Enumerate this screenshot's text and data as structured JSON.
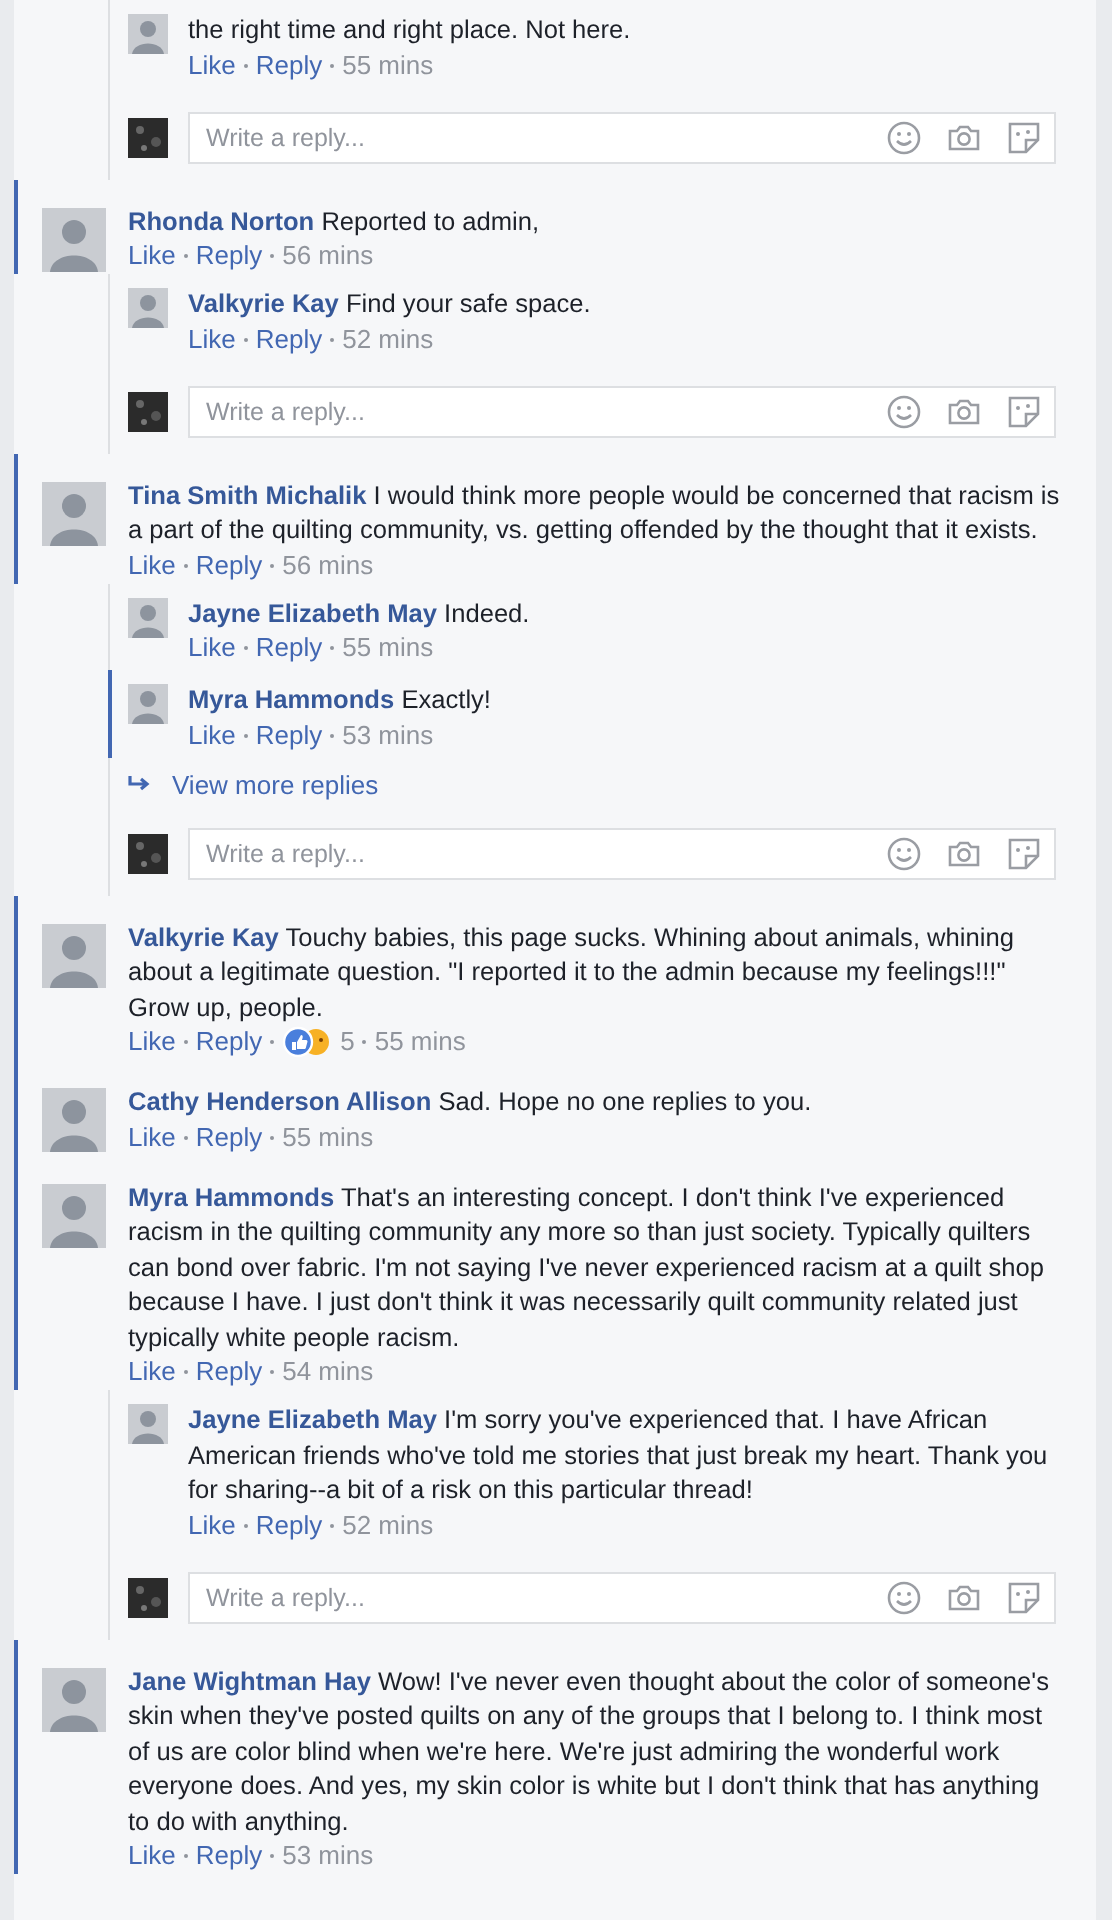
{
  "items": [
    {
      "kind": "reply",
      "unread": false,
      "text": "the right time and right place. Not here.",
      "like": "Like",
      "reply": "Reply",
      "time": "55 mins"
    },
    {
      "kind": "reply_box",
      "placeholder": "Write a reply..."
    },
    {
      "kind": "comment",
      "unread": true,
      "author": "Rhonda Norton",
      "text": "Reported to admin,",
      "like": "Like",
      "reply": "Reply",
      "time": "56 mins"
    },
    {
      "kind": "reply",
      "unread": false,
      "author": "Valkyrie Kay",
      "text": "Find your safe space.",
      "like": "Like",
      "reply": "Reply",
      "time": "52 mins"
    },
    {
      "kind": "reply_box",
      "placeholder": "Write a reply..."
    },
    {
      "kind": "comment",
      "unread": true,
      "author": "Tina Smith Michalik",
      "text": "I would think more people would be concerned that racism is a part of the quilting community, vs. getting offended by the thought that it exists.",
      "like": "Like",
      "reply": "Reply",
      "time": "56 mins"
    },
    {
      "kind": "reply",
      "unread": false,
      "author": "Jayne Elizabeth May",
      "text": "Indeed.",
      "like": "Like",
      "reply": "Reply",
      "time": "55 mins"
    },
    {
      "kind": "reply",
      "unread": true,
      "author": "Myra Hammonds",
      "text": "Exactly!",
      "like": "Like",
      "reply": "Reply",
      "time": "53 mins"
    },
    {
      "kind": "more_replies",
      "label": "View more replies"
    },
    {
      "kind": "reply_box",
      "placeholder": "Write a reply..."
    },
    {
      "kind": "comment",
      "unread": true,
      "author": "Valkyrie Kay",
      "text": "Touchy babies, this page sucks. Whining about animals, whining about a legitimate question. \"I reported it to the admin because my feelings!!!\" Grow up, people.",
      "like": "Like",
      "reply": "Reply",
      "reaction_count": "5",
      "time": "55 mins"
    },
    {
      "kind": "comment",
      "unread": true,
      "author": "Cathy Henderson Allison",
      "text": "Sad. Hope no one replies to you.",
      "like": "Like",
      "reply": "Reply",
      "time": "55 mins"
    },
    {
      "kind": "comment",
      "unread": true,
      "author": "Myra Hammonds",
      "text": "That's an interesting concept. I don't think I've experienced racism in the quilting community any more so than just society. Typically quilters can bond over fabric. I'm not saying I've never experienced racism at a quilt shop because I have. I just don't think it was necessarily quilt community related just typically white people racism.",
      "like": "Like",
      "reply": "Reply",
      "time": "54 mins"
    },
    {
      "kind": "reply",
      "unread": false,
      "author": "Jayne Elizabeth May",
      "text": "I'm sorry you've experienced that. I have African American friends who've told me stories that just break my heart. Thank you for sharing--a bit of a risk on this particular thread!",
      "like": "Like",
      "reply": "Reply",
      "time": "52 mins"
    },
    {
      "kind": "reply_box",
      "placeholder": "Write a reply..."
    },
    {
      "kind": "comment",
      "unread": true,
      "author": "Jane Wightman Hay",
      "text": "Wow! I've never even thought about the color of someone's skin when they've posted quilts on any of the groups that I belong to. I think most of us are color blind when we're here. We're just admiring the wonderful work everyone does. And yes, my skin color is white but I don't think that has anything to do with anything.",
      "like": "Like",
      "reply": "Reply",
      "time": "53 mins"
    }
  ]
}
